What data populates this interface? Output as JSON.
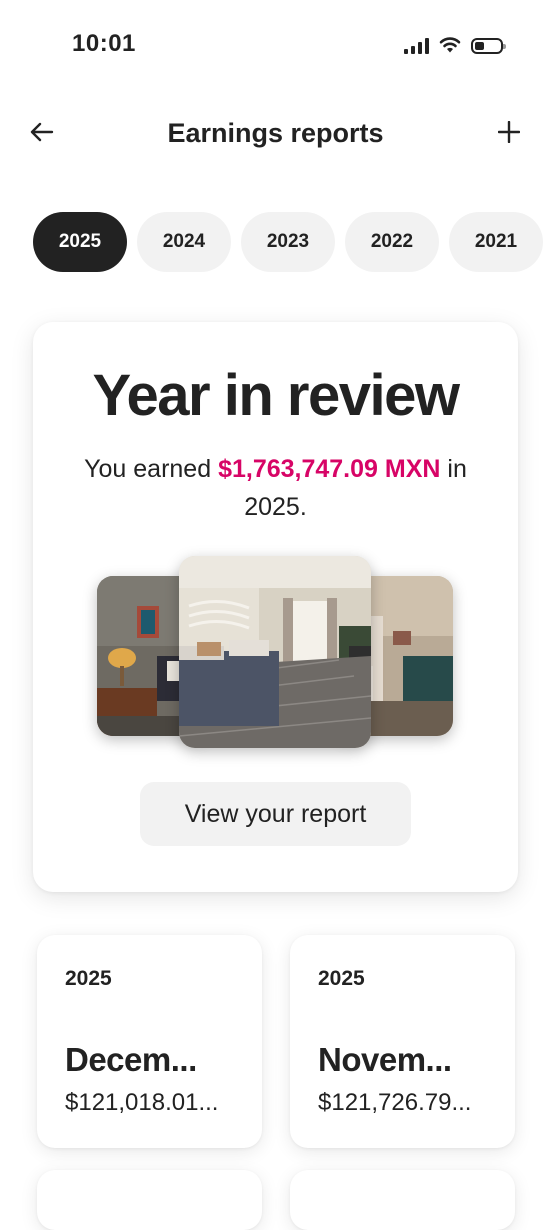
{
  "status_bar": {
    "time": "10:01"
  },
  "header": {
    "title": "Earnings reports",
    "back_icon": "arrow-left-icon",
    "add_icon": "plus-icon"
  },
  "year_tabs": [
    "2025",
    "2024",
    "2023",
    "2022",
    "2021"
  ],
  "selected_year": "2025",
  "review": {
    "title": "Year in review",
    "text_prefix": "You earned ",
    "amount": "$1,763,747.09 MXN",
    "text_suffix": " in 2025.",
    "button_label": "View your report",
    "accent_color": "#d70466"
  },
  "monthly_cards": [
    {
      "year": "2025",
      "month": "Decem...",
      "amount": "$121,018.01..."
    },
    {
      "year": "2025",
      "month": "Novem...",
      "amount": "$121,726.79..."
    }
  ]
}
